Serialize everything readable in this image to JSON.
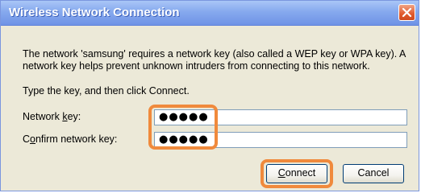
{
  "window": {
    "title": "Wireless Network Connection",
    "close_icon": "close-icon"
  },
  "message": "The network 'samsung' requires a network key (also called a WEP key or WPA key). A network key helps prevent unknown intruders from connecting to this network.",
  "instruction": "Type the key, and then click Connect.",
  "fields": {
    "network_key": {
      "label_pre": "Network ",
      "label_access": "k",
      "label_post": "ey:",
      "value": "●●●●●"
    },
    "confirm_key": {
      "label_pre": "C",
      "label_access": "o",
      "label_post": "nfirm network key:",
      "value": "●●●●●"
    }
  },
  "buttons": {
    "connect_access": "C",
    "connect_rest": "onnect",
    "cancel": "Cancel"
  },
  "colors": {
    "dialog_bg": "#ece9d8",
    "titlebar": "#86a9ee",
    "highlight": "#f08a3c",
    "close_button": "#e15a2d"
  }
}
